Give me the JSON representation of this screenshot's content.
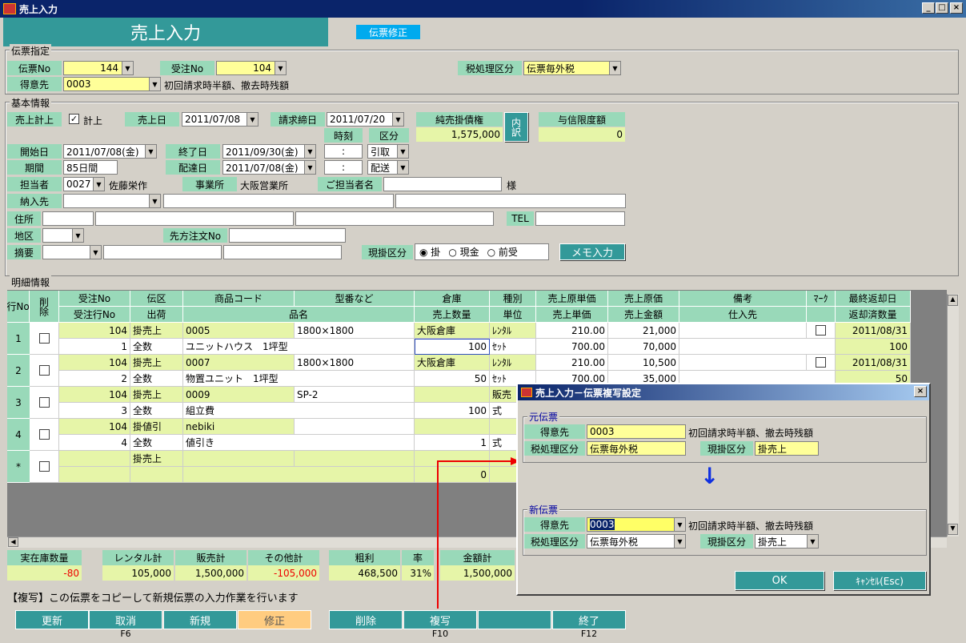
{
  "window": {
    "title": "売上入力",
    "min": "_",
    "max": "□",
    "close": "×"
  },
  "header": {
    "title": "売上入力",
    "mode": "伝票修正"
  },
  "denpyo": {
    "group": "伝票指定",
    "no_label": "伝票No",
    "no_value": "144",
    "juchu_label": "受注No",
    "juchu_value": "104",
    "tokui_label": "得意先",
    "tokui_value": "0003",
    "tokui_name": "初回請求時半額、撤去時残額",
    "tax_label": "税処理区分",
    "tax_value": "伝票毎外税"
  },
  "kihon": {
    "group": "基本情報",
    "keijo_label": "売上計上",
    "keijo_check": "✓",
    "keijo_text": "計上",
    "uriagebi_label": "売上日",
    "uriagebi_value": "2011/07/08",
    "seikyu_label": "請求締日",
    "seikyu_value": "2011/07/20",
    "junuri_label": "純売掛債権",
    "junuri_value": "1,575,000",
    "uchiwake": "内訳",
    "yoshin_label": "与信限度額",
    "yoshin_value": "0",
    "jikoku_label": "時刻",
    "kubun_label": "区分",
    "kaishi_label": "開始日",
    "kaishi_value": "2011/07/08(金)",
    "shuryo_label": "終了日",
    "shuryo_value": "2011/09/30(金)",
    "time1": ":",
    "kubun1": "引取",
    "kikan_label": "期間",
    "kikan_value": "85日間",
    "haiso_label": "配達日",
    "haiso_value": "2011/07/08(金)",
    "time2": ":",
    "kubun2": "配送",
    "tanto_label": "担当者",
    "tanto_code": "0027",
    "tanto_name": "佐藤栄作",
    "jigyo_label": "事業所",
    "jigyo_value": "大阪営業所",
    "gotanto_label": "ご担当者名",
    "sama": "様",
    "nonyu_label": "納入先",
    "jusho_label": "住所",
    "tel_label": "TEL",
    "chiku_label": "地区",
    "sakichu_label": "先方注文No",
    "tekiyo_label": "摘要",
    "genkake_label": "現掛区分",
    "radio1": "掛",
    "radio2": "現金",
    "radio3": "前受",
    "memo_btn": "メモ入力"
  },
  "meisai": {
    "group": "明細情報",
    "headers1": [
      "行No",
      "削除",
      "受注No",
      "伝区",
      "商品コード",
      "型番など",
      "倉庫",
      "種別",
      "売上原単価",
      "売上原価",
      "備考",
      "ﾏｰｸ",
      "最終返却日"
    ],
    "headers2": [
      "受注行No",
      "出荷",
      "品名",
      "売上数量",
      "単位",
      "売上単価",
      "売上金額",
      "仕入先",
      "返却済数量"
    ],
    "rows": [
      {
        "no": "1",
        "juchu": "104",
        "den": "掛売上",
        "code": "0005",
        "kata": "1800×1800",
        "soko": "大阪倉庫",
        "shubetsu": "ﾚﾝﾀﾙ",
        "genka_tan": "210.00",
        "genka": "21,000",
        "henkyaku": "2011/08/31",
        "gyo": "1",
        "shukka": "全数",
        "hinmei": "ユニットハウス　1坪型",
        "suryo": "100",
        "tani": "ｾｯﾄ",
        "tanka": "700.00",
        "kingaku": "70,000",
        "henzumi": "100"
      },
      {
        "no": "2",
        "juchu": "104",
        "den": "掛売上",
        "code": "0007",
        "kata": "1800×1800",
        "soko": "大阪倉庫",
        "shubetsu": "ﾚﾝﾀﾙ",
        "genka_tan": "210.00",
        "genka": "10,500",
        "henkyaku": "2011/08/31",
        "gyo": "2",
        "shukka": "全数",
        "hinmei": "物置ユニット　1坪型",
        "suryo": "50",
        "tani": "ｾｯﾄ",
        "tanka": "700.00",
        "kingaku": "35,000",
        "henzumi": "50"
      },
      {
        "no": "3",
        "juchu": "104",
        "den": "掛売上",
        "code": "0009",
        "kata": "SP-2",
        "soko": "",
        "shubetsu": "販売",
        "genka_tan": "",
        "genka": "",
        "henkyaku": "",
        "gyo": "3",
        "shukka": "全数",
        "hinmei": "組立費",
        "suryo": "100",
        "tani": "式",
        "tanka": "",
        "kingaku": "",
        "henzumi": ""
      },
      {
        "no": "4",
        "juchu": "104",
        "den": "掛値引",
        "code": "nebiki",
        "kata": "",
        "soko": "",
        "shubetsu": "",
        "genka_tan": "",
        "genka": "",
        "henkyaku": "",
        "gyo": "4",
        "shukka": "全数",
        "hinmei": "値引き",
        "suryo": "1",
        "tani": "式",
        "tanka": "",
        "kingaku": "",
        "henzumi": ""
      },
      {
        "no": "*",
        "juchu": "",
        "den": "掛売上",
        "code": "",
        "kata": "",
        "soko": "",
        "shubetsu": "",
        "genka_tan": "",
        "genka": "",
        "henkyaku": "",
        "gyo": "",
        "shukka": "",
        "hinmei": "",
        "suryo": "0",
        "tani": "",
        "tanka": "",
        "kingaku": "",
        "henzumi": ""
      }
    ]
  },
  "totals": {
    "labels": [
      "実在庫数量",
      "レンタル計",
      "販売計",
      "その他計",
      "粗利",
      "率",
      "金額計"
    ],
    "values": [
      "-80",
      "105,000",
      "1,500,000",
      "-105,000",
      "468,500",
      "31%",
      "1,500,000"
    ]
  },
  "status": "【複写】この伝票をコピーして新規伝票の入力作業を行います",
  "fkeys": [
    {
      "label": "更新",
      "key": ""
    },
    {
      "label": "取消",
      "key": "F6"
    },
    {
      "label": "新規",
      "key": ""
    },
    {
      "label": "修正",
      "key": ""
    },
    {
      "label": "削除",
      "key": ""
    },
    {
      "label": "複写",
      "key": "F10"
    },
    {
      "label": "",
      "key": ""
    },
    {
      "label": "終了",
      "key": "F12"
    }
  ],
  "dialog": {
    "title": "売上入力－伝票複写設定",
    "close": "×",
    "moto_group": "元伝票",
    "tokui_label": "得意先",
    "moto_tokui": "0003",
    "moto_name": "初回請求時半額、撤去時残額",
    "tax_label": "税処理区分",
    "moto_tax": "伝票毎外税",
    "genkake_label": "現掛区分",
    "moto_genkake": "掛売上",
    "arrow": "↓",
    "shin_group": "新伝票",
    "shin_tokui": "0003",
    "shin_name": "初回請求時半額、撤去時残額",
    "shin_tax": "伝票毎外税",
    "shin_genkake": "掛売上",
    "ok": "OK",
    "cancel": "ｷｬﾝｾﾙ(Esc)"
  }
}
